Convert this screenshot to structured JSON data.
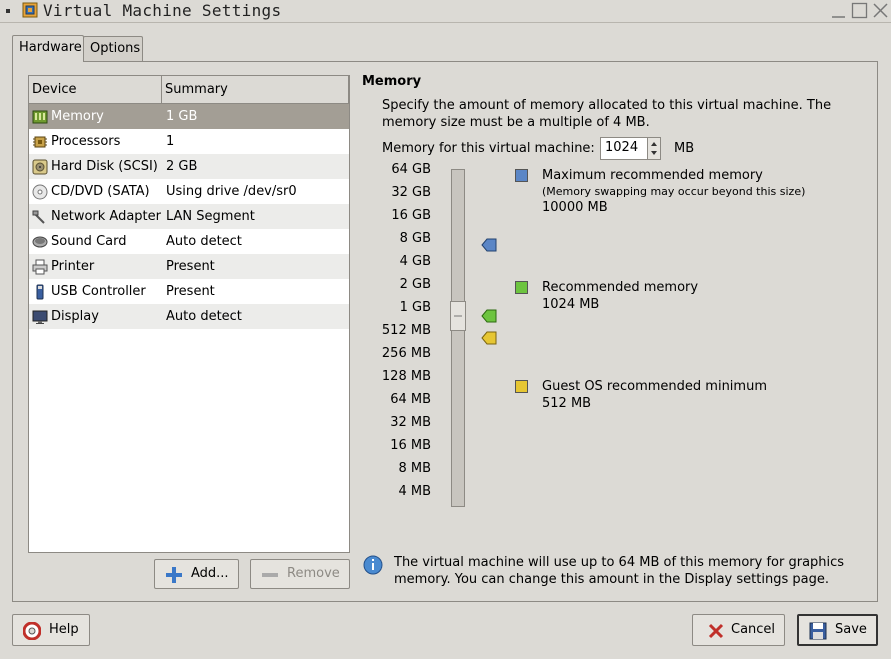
{
  "window": {
    "title": "Virtual Machine Settings"
  },
  "tabs": [
    {
      "label": "Hardware",
      "active": true
    },
    {
      "label": "Options",
      "active": false
    }
  ],
  "device_list": {
    "columns": [
      "Device",
      "Summary"
    ],
    "rows": [
      {
        "icon": "memory-icon",
        "device": "Memory",
        "summary": "1 GB",
        "selected": true
      },
      {
        "icon": "processor-icon",
        "device": "Processors",
        "summary": "1"
      },
      {
        "icon": "hard-disk-icon",
        "device": "Hard Disk (SCSI)",
        "summary": "2 GB"
      },
      {
        "icon": "cd-dvd-icon",
        "device": "CD/DVD (SATA)",
        "summary": "Using drive /dev/sr0"
      },
      {
        "icon": "network-adapter-icon",
        "device": "Network Adapter",
        "summary": "LAN Segment"
      },
      {
        "icon": "sound-card-icon",
        "device": "Sound Card",
        "summary": "Auto detect"
      },
      {
        "icon": "printer-icon",
        "device": "Printer",
        "summary": "Present"
      },
      {
        "icon": "usb-controller-icon",
        "device": "USB Controller",
        "summary": "Present"
      },
      {
        "icon": "display-icon",
        "device": "Display",
        "summary": "Auto detect"
      }
    ]
  },
  "list_buttons": {
    "add": "Add...",
    "remove": "Remove"
  },
  "memory": {
    "title": "Memory",
    "description": "Specify the amount of memory allocated to this virtual machine. The memory size must be a multiple of 4 MB.",
    "field_label": "Memory for this virtual machine:",
    "value": "1024",
    "unit": "MB",
    "scale": [
      "64 GB",
      "32 GB",
      "16 GB",
      "8 GB",
      "4 GB",
      "2 GB",
      "1 GB",
      "512 MB",
      "256 MB",
      "128 MB",
      "64 MB",
      "32 MB",
      "16 MB",
      "8 MB",
      "4 MB"
    ],
    "slider_value": "1 GB",
    "legend": [
      {
        "title": "Maximum recommended memory",
        "note": "(Memory swapping may occur beyond this size)",
        "value": "10000 MB",
        "color": "#5b86c6"
      },
      {
        "title": "Recommended memory",
        "note": "",
        "value": "1024 MB",
        "color": "#6dc43f"
      },
      {
        "title": "Guest OS recommended minimum",
        "note": "",
        "value": "512 MB",
        "color": "#e6c633"
      }
    ],
    "markers": [
      {
        "at": "8 GB",
        "color": "#5b86c6"
      },
      {
        "at": "1 GB",
        "color": "#6dc43f"
      },
      {
        "at": "512 MB",
        "color": "#e6c633"
      }
    ],
    "info": "The virtual machine will use up to 64 MB of this memory for graphics memory. You can change this amount in the Display settings page."
  },
  "footer": {
    "help": "Help",
    "cancel": "Cancel",
    "save": "Save"
  }
}
